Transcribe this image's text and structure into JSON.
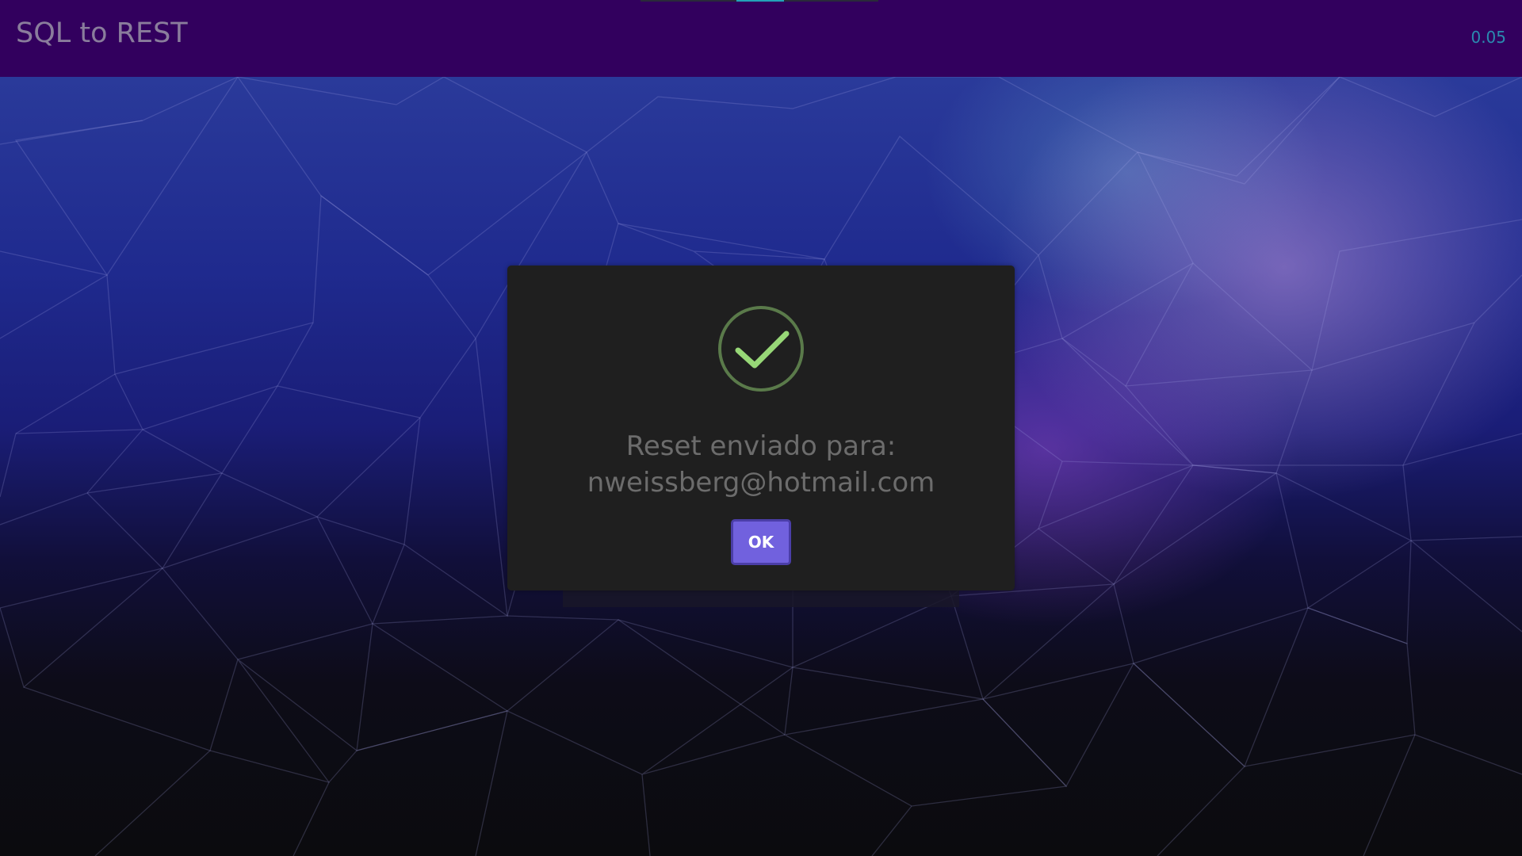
{
  "header": {
    "title": "SQL to REST",
    "version": "0.05"
  },
  "dialog": {
    "icon": "check-circle-icon",
    "message_line1": "Reset enviado para:",
    "message_line2": "nweissberg@hotmail.com",
    "ok_label": "OK"
  },
  "colors": {
    "topbar": "#32005e",
    "dialog_bg": "#1f1f1f",
    "ok_button": "#7161de",
    "success_green": "#8fd16b",
    "version_text": "#2a8bb0"
  }
}
